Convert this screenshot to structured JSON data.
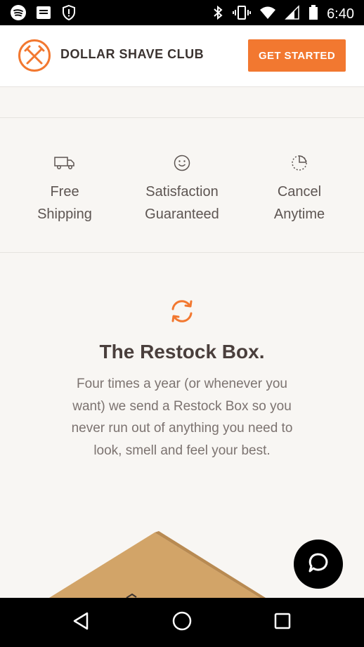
{
  "status_bar": {
    "time": "6:40",
    "left_icons": [
      "spotify-icon",
      "message-icon",
      "shield-icon"
    ],
    "right_icons": [
      "bluetooth-icon",
      "vibrate-icon",
      "wifi-icon",
      "signal-icon",
      "battery-icon"
    ]
  },
  "header": {
    "brand": "DOLLAR SHAVE CLUB",
    "cta_label": "GET STARTED",
    "accent_color": "#f27830"
  },
  "features": [
    {
      "icon": "truck-icon",
      "label_line1": "Free",
      "label_line2": "Shipping"
    },
    {
      "icon": "smiley-icon",
      "label_line1": "Satisfaction",
      "label_line2": "Guaranteed"
    },
    {
      "icon": "clock-icon",
      "label_line1": "Cancel",
      "label_line2": "Anytime"
    }
  ],
  "restock": {
    "icon": "refresh-icon",
    "title": "The Restock Box.",
    "body": "Four times a year (or whenever you want) we send a Restock Box so you never run out of anything you need to look, smell and feel your best."
  },
  "chat": {
    "icon": "chat-icon"
  },
  "nav": {
    "icons": [
      "back-icon",
      "home-icon",
      "recents-icon"
    ]
  }
}
